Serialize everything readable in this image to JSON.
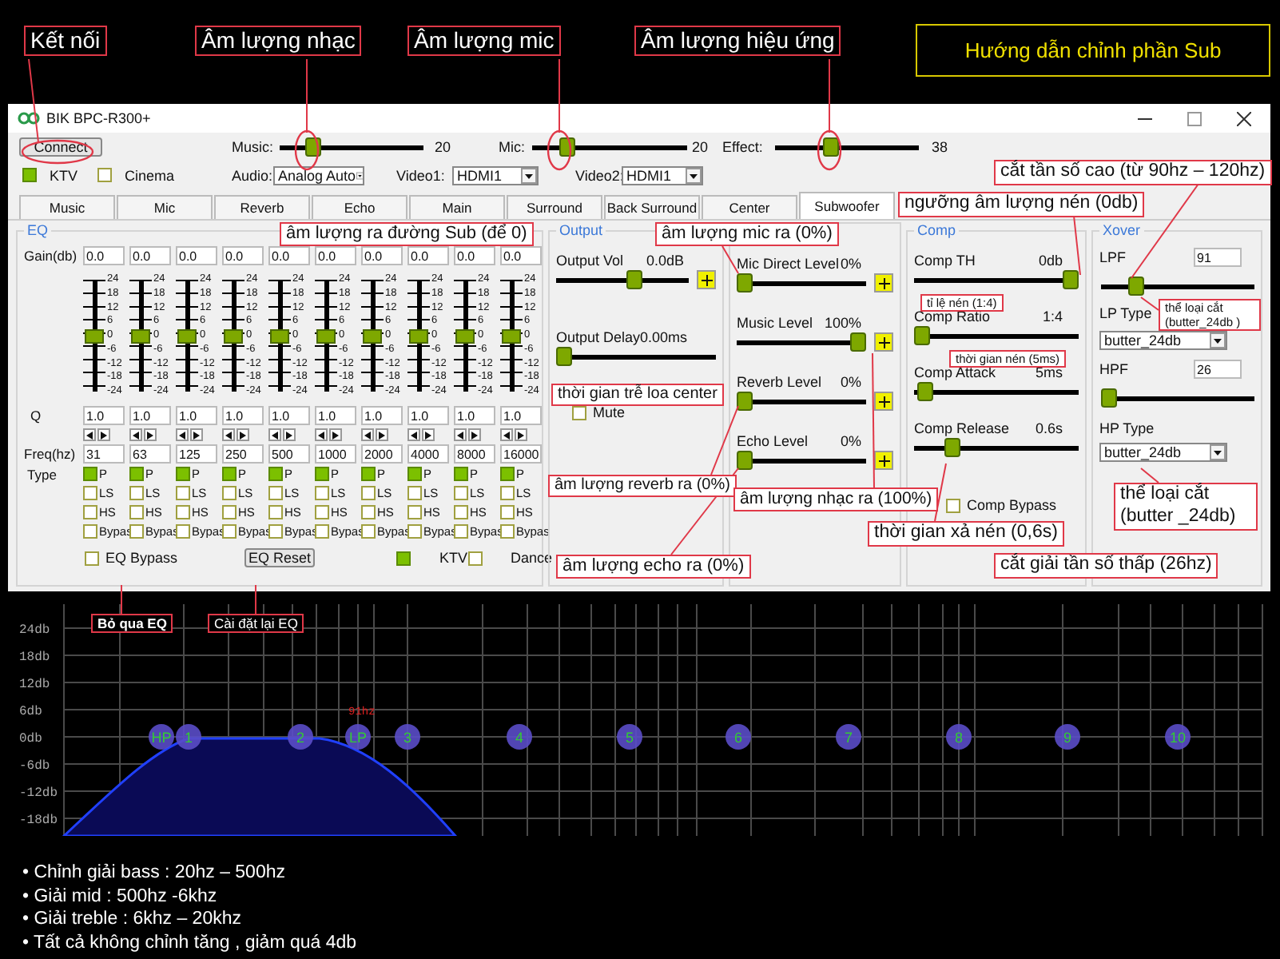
{
  "top_callouts": [
    "Kết nối",
    "Âm lượng nhạc",
    "Âm lượng mic",
    "Âm lượng hiệu ứng"
  ],
  "guide_title": "Hướng dẫn chỉnh phần Sub",
  "window": {
    "title": "BIK BPC-R300+"
  },
  "connect_button": "Connect",
  "volumes": [
    {
      "label": "Music:",
      "level": 0.2,
      "value": "20"
    },
    {
      "label": "Mic:",
      "level": 0.2,
      "value": "20"
    },
    {
      "label": "Effect:",
      "level": 0.38,
      "value": "38"
    }
  ],
  "modes": [
    {
      "label": "KTV",
      "checked": true
    },
    {
      "label": "Cinema",
      "checked": false
    }
  ],
  "selects": [
    {
      "label": "Audio:",
      "value": "Analog Auto"
    },
    {
      "label": "Video1:",
      "value": "HDMI1"
    },
    {
      "label": "Video2:",
      "value": "HDMI1"
    }
  ],
  "tabs": [
    {
      "label": "Music",
      "selected": false
    },
    {
      "label": "Mic",
      "selected": false
    },
    {
      "label": "Reverb",
      "selected": false
    },
    {
      "label": "Echo",
      "selected": false
    },
    {
      "label": "Main",
      "selected": false
    },
    {
      "label": "Surround",
      "selected": false
    },
    {
      "label": "Back Surround",
      "selected": false
    },
    {
      "label": "Center",
      "selected": false
    },
    {
      "label": "Subwoofer",
      "selected": true
    }
  ],
  "eq": {
    "title": "EQ",
    "gain_label": "Gain(db)",
    "q_label": "Q",
    "freq_label": "Freq(hz)",
    "type_label": "Type",
    "bands": [
      {
        "gain": "0.0",
        "level": 0.5,
        "scale": [
          "24",
          "18",
          "12",
          "6",
          "0",
          "-6",
          "-12",
          "-18",
          "-24"
        ],
        "q": "1.0",
        "freq": "31",
        "types": [
          {
            "label": "P",
            "checked": true
          },
          {
            "label": "LS",
            "checked": false
          },
          {
            "label": "HS",
            "checked": false
          },
          {
            "label": "Bypas",
            "checked": false
          }
        ]
      },
      {
        "gain": "0.0",
        "level": 0.5,
        "scale": [
          "24",
          "18",
          "12",
          "6",
          "0",
          "-6",
          "-12",
          "-18",
          "-24"
        ],
        "q": "1.0",
        "freq": "63",
        "types": [
          {
            "label": "P",
            "checked": true
          },
          {
            "label": "LS",
            "checked": false
          },
          {
            "label": "HS",
            "checked": false
          },
          {
            "label": "Bypas",
            "checked": false
          }
        ]
      },
      {
        "gain": "0.0",
        "level": 0.5,
        "scale": [
          "24",
          "18",
          "12",
          "6",
          "0",
          "-6",
          "-12",
          "-18",
          "-24"
        ],
        "q": "1.0",
        "freq": "125",
        "types": [
          {
            "label": "P",
            "checked": true
          },
          {
            "label": "LS",
            "checked": false
          },
          {
            "label": "HS",
            "checked": false
          },
          {
            "label": "Bypas",
            "checked": false
          }
        ]
      },
      {
        "gain": "0.0",
        "level": 0.5,
        "scale": [
          "24",
          "18",
          "12",
          "6",
          "0",
          "-6",
          "-12",
          "-18",
          "-24"
        ],
        "q": "1.0",
        "freq": "250",
        "types": [
          {
            "label": "P",
            "checked": true
          },
          {
            "label": "LS",
            "checked": false
          },
          {
            "label": "HS",
            "checked": false
          },
          {
            "label": "Bypas",
            "checked": false
          }
        ]
      },
      {
        "gain": "0.0",
        "level": 0.5,
        "scale": [
          "24",
          "18",
          "12",
          "6",
          "0",
          "-6",
          "-12",
          "-18",
          "-24"
        ],
        "q": "1.0",
        "freq": "500",
        "types": [
          {
            "label": "P",
            "checked": true
          },
          {
            "label": "LS",
            "checked": false
          },
          {
            "label": "HS",
            "checked": false
          },
          {
            "label": "Bypas",
            "checked": false
          }
        ]
      },
      {
        "gain": "0.0",
        "level": 0.5,
        "scale": [
          "24",
          "18",
          "12",
          "6",
          "0",
          "-6",
          "-12",
          "-18",
          "-24"
        ],
        "q": "1.0",
        "freq": "1000",
        "types": [
          {
            "label": "P",
            "checked": true
          },
          {
            "label": "LS",
            "checked": false
          },
          {
            "label": "HS",
            "checked": false
          },
          {
            "label": "Bypas",
            "checked": false
          }
        ]
      },
      {
        "gain": "0.0",
        "level": 0.5,
        "scale": [
          "24",
          "18",
          "12",
          "6",
          "0",
          "-6",
          "-12",
          "-18",
          "-24"
        ],
        "q": "1.0",
        "freq": "2000",
        "types": [
          {
            "label": "P",
            "checked": true
          },
          {
            "label": "LS",
            "checked": false
          },
          {
            "label": "HS",
            "checked": false
          },
          {
            "label": "Bypas",
            "checked": false
          }
        ]
      },
      {
        "gain": "0.0",
        "level": 0.5,
        "scale": [
          "24",
          "18",
          "12",
          "6",
          "0",
          "-6",
          "-12",
          "-18",
          "-24"
        ],
        "q": "1.0",
        "freq": "4000",
        "types": [
          {
            "label": "P",
            "checked": true
          },
          {
            "label": "LS",
            "checked": false
          },
          {
            "label": "HS",
            "checked": false
          },
          {
            "label": "Bypas",
            "checked": false
          }
        ]
      },
      {
        "gain": "0.0",
        "level": 0.5,
        "scale": [
          "24",
          "18",
          "12",
          "6",
          "0",
          "-6",
          "-12",
          "-18",
          "-24"
        ],
        "q": "1.0",
        "freq": "8000",
        "types": [
          {
            "label": "P",
            "checked": true
          },
          {
            "label": "LS",
            "checked": false
          },
          {
            "label": "HS",
            "checked": false
          },
          {
            "label": "Bypas",
            "checked": false
          }
        ]
      },
      {
        "gain": "0.0",
        "level": 0.5,
        "scale": [
          "24",
          "18",
          "12",
          "6",
          "0",
          "-6",
          "-12",
          "-18",
          "-24"
        ],
        "q": "1.0",
        "freq": "16000",
        "types": [
          {
            "label": "P",
            "checked": true
          },
          {
            "label": "LS",
            "checked": false
          },
          {
            "label": "HS",
            "checked": false
          },
          {
            "label": "Bypas",
            "checked": false
          }
        ]
      }
    ],
    "bypass": {
      "label": "EQ Bypass",
      "checked": false
    },
    "reset_button": "EQ Reset",
    "presets": [
      {
        "label": "KTV",
        "checked": true
      },
      {
        "label": "Dance",
        "checked": false
      }
    ]
  },
  "output": {
    "title": "Output",
    "sliders": [
      {
        "plus_button": true,
        "label": "Output Vol",
        "value": "0.0dB",
        "level": 0.6
      },
      {
        "plus_button": false,
        "label": "Output Delay",
        "value": "0.00ms",
        "level": 0
      }
    ],
    "mute": {
      "label": "Mute",
      "checked": false
    }
  },
  "levels": {
    "sliders": [
      {
        "plus_button": true,
        "label": "Mic Direct Level",
        "value": "0%",
        "level": 0
      },
      {
        "plus_button": true,
        "label": "Music Level",
        "value": "100%",
        "level": 1
      },
      {
        "plus_button": true,
        "label": "Reverb Level",
        "value": "0%",
        "level": 0
      },
      {
        "plus_button": true,
        "label": "Echo Level",
        "value": "0%",
        "level": 0
      }
    ]
  },
  "comp": {
    "title": "Comp",
    "sliders": [
      {
        "label": "Comp TH",
        "value": "0db",
        "level": 1
      },
      {
        "label": "Comp Ratio",
        "value": "1:4",
        "level": 0
      },
      {
        "label": "Comp Attack",
        "value": "5ms",
        "level": 0.02
      },
      {
        "label": "Comp Release",
        "value": "0.6s",
        "level": 0.2
      }
    ],
    "bypass": {
      "label": "Comp Bypass",
      "checked": false
    }
  },
  "xover": {
    "title": "Xover",
    "lpf": {
      "label": "LPF",
      "value": "91",
      "level": 0.2
    },
    "lp_type": {
      "label": "LP Type",
      "value": "butter_24db"
    },
    "hpf": {
      "label": "HPF",
      "value": "26",
      "level": 0
    },
    "hp_type": {
      "label": "HP Type",
      "value": "butter_24db"
    }
  },
  "annotations": [
    "âm lượng ra đường Sub (để 0)",
    "âm lượng mic ra (0%)",
    "cắt tần số cao (từ 90hz – 120hz)",
    "ngưỡng âm lượng nén (0db)",
    "tỉ lệ nén (1:4)",
    "thể loại cắt (butter_24db )",
    "thời gian nén (5ms)",
    "thời gian trễ loa center",
    "âm lượng reverb ra (0%)",
    "âm lượng nhạc ra (100%)",
    "thể loại cắt (butter _24db)",
    "thời gian xả nén (0,6s)",
    "âm lượng echo ra (0%)",
    "cắt giải tần số thấp (26hz)",
    "Bỏ qua EQ",
    "Cài đặt lại EQ"
  ],
  "graph": {
    "y_labels": [
      "24db",
      "18db",
      "12db",
      "6db",
      "0db",
      "-6db",
      "-12db",
      "-18db"
    ],
    "nodes": [
      "HP",
      "1",
      "2",
      "LP",
      "3",
      "4",
      "5",
      "6",
      "7",
      "8",
      "9",
      "10"
    ],
    "marker": "91hz"
  },
  "notes": [
    "• Chỉnh giải bass : 20hz – 500hz",
    "• Giải mid : 500hz -6khz",
    "• Giải treble : 6khz – 20khz",
    "• Tất cả không chỉnh tăng , giảm quá 4db"
  ]
}
